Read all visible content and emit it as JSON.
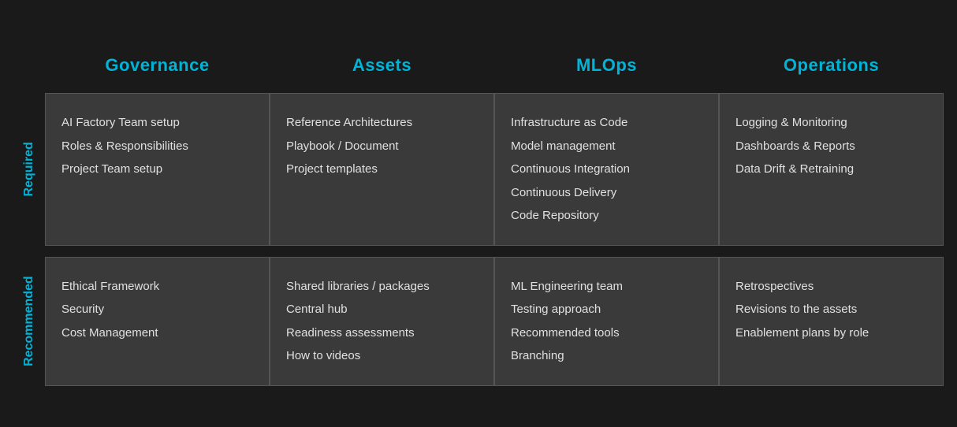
{
  "headers": {
    "col1": "Governance",
    "col2": "Assets",
    "col3": "MLOps",
    "col4": "Operations"
  },
  "rows": {
    "required": {
      "label": "Required",
      "governance": [
        "AI Factory Team setup",
        "Roles & Responsibilities",
        "Project Team setup"
      ],
      "assets": [
        "Reference Architectures",
        "Playbook / Document",
        "Project templates"
      ],
      "mlops": [
        "Infrastructure as Code",
        "Model management",
        "Continuous Integration",
        "Continuous Delivery",
        "Code Repository"
      ],
      "operations": [
        "Logging & Monitoring",
        "Dashboards & Reports",
        "Data Drift & Retraining"
      ]
    },
    "recommended": {
      "label": "Recommended",
      "governance": [
        "Ethical Framework",
        "Security",
        "Cost Management"
      ],
      "assets": [
        "Shared libraries / packages",
        "Central hub",
        "Readiness assessments",
        "How to videos"
      ],
      "mlops": [
        "ML Engineering team",
        "Testing approach",
        "Recommended tools",
        "Branching"
      ],
      "operations": [
        "Retrospectives",
        "Revisions to the assets",
        "Enablement plans by role"
      ]
    }
  }
}
